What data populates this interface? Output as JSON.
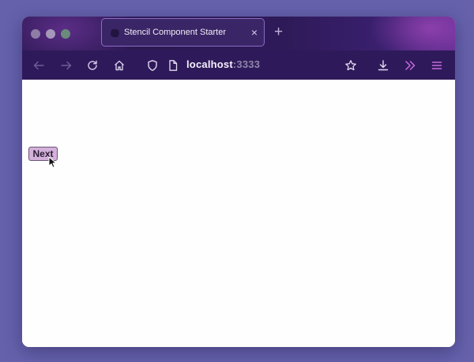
{
  "window": {
    "traffic_lights": [
      "close",
      "minimize",
      "maximize"
    ]
  },
  "tab": {
    "title": "Stencil Component Starter",
    "close_glyph": "×",
    "favicon": "stencil-logo-icon"
  },
  "newtab_glyph": "+",
  "toolbar": {
    "icons": [
      "back-arrow-icon",
      "forward-arrow-icon",
      "reload-icon",
      "home-icon",
      "shield-icon",
      "page-icon",
      "star-icon",
      "download-icon",
      "overflow-chevrons-icon",
      "menu-icon"
    ],
    "url_host": "localhost",
    "url_port": ":3333"
  },
  "page": {
    "next_label": "Next"
  },
  "colors": {
    "background": "#6561ab",
    "titlebar": "#2e1a58",
    "toolbar": "#2e1a5a",
    "accent": "#c46bdd",
    "button": "#d3b1da"
  }
}
